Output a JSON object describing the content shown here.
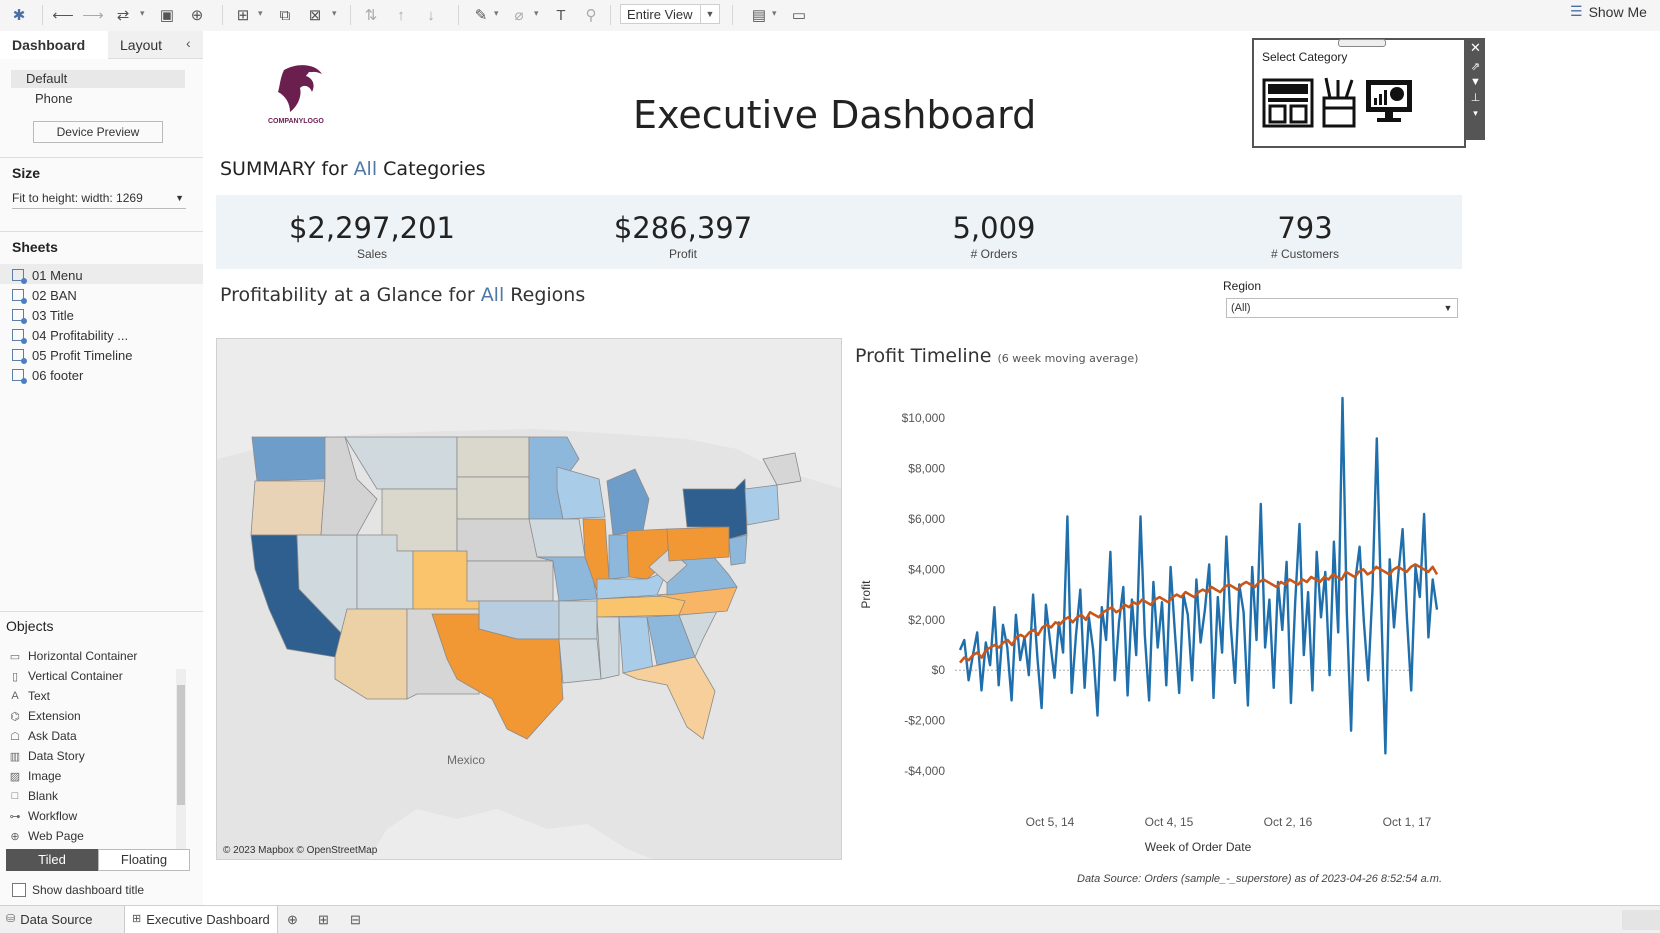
{
  "toolbar": {
    "entire_view": "Entire View",
    "show_me": "Show Me"
  },
  "left_pane": {
    "tabs": [
      "Dashboard",
      "Layout"
    ],
    "device": {
      "default": "Default",
      "phone": "Phone",
      "preview_button": "Device Preview"
    },
    "size": {
      "heading": "Size",
      "value": "Fit to height: width: 1269"
    },
    "sheets": {
      "heading": "Sheets",
      "items": [
        "01 Menu",
        "02 BAN",
        "03 Title",
        "04 Profitability ...",
        "05 Profit Timeline",
        "06 footer"
      ]
    },
    "objects": {
      "heading": "Objects",
      "items": [
        "Horizontal Container",
        "Vertical Container",
        "Text",
        "Extension",
        "Ask Data",
        "Data Story",
        "Image",
        "Blank",
        "Workflow",
        "Web Page"
      ]
    },
    "tiled": "Tiled",
    "floating": "Floating",
    "show_title": "Show dashboard title"
  },
  "dashboard": {
    "logo_text": "COMPANYLOGO",
    "title": "Executive Dashboard",
    "summary": {
      "prefix": "SUMMARY for ",
      "highlight": "All",
      "suffix": " Categories"
    },
    "bans": [
      {
        "value": "$2,297,201",
        "label": "Sales"
      },
      {
        "value": "$286,397",
        "label": "Profit"
      },
      {
        "value": "5,009",
        "label": "# Orders"
      },
      {
        "value": "793",
        "label": "# Customers"
      }
    ],
    "profitability": {
      "prefix": "Profitability at a Glance for ",
      "highlight": "All",
      "suffix": " Regions"
    },
    "region": {
      "label": "Region",
      "value": "(All)"
    },
    "map": {
      "label_mexico": "Mexico",
      "credit": "© 2023 Mapbox © OpenStreetMap"
    },
    "category_popup": {
      "title": "Select Category"
    },
    "footer": "Data Source: Orders (sample_-_superstore) as of 2023-04-26 8:52:54 a.m."
  },
  "bottom_bar": {
    "data_source": "Data Source",
    "active_tab": "Executive Dashboard"
  },
  "chart_data": {
    "type": "line",
    "title": "Profit Timeline",
    "subtitle": "(6 week moving average)",
    "xlabel": "Week of Order Date",
    "ylabel": "Profit",
    "y_ticks": [
      "$10,000",
      "$8,000",
      "$6,000",
      "$4,000",
      "$2,000",
      "$0",
      "-$2,000",
      "-$4,000"
    ],
    "x_ticks": [
      "Oct 5, 14",
      "Oct 4, 15",
      "Oct 2, 16",
      "Oct 1, 17"
    ],
    "ylim": [
      -4000,
      11000
    ],
    "colors": {
      "weekly": "#1f6fad",
      "moving_avg": "#c8571b"
    },
    "series": [
      {
        "values": [
          800,
          1200,
          -400,
          600,
          1500,
          -800,
          1100,
          200,
          2500,
          -600,
          1800,
          900,
          -1200,
          2200,
          400,
          1300,
          -200,
          3000,
          500,
          -1500,
          2600,
          1100,
          -300,
          1900,
          700,
          6100,
          -900,
          1400,
          3200,
          -700,
          2100,
          800,
          -1800,
          2500,
          1200,
          4700,
          -400,
          1900,
          3300,
          -1000,
          2800,
          600,
          6100,
          1400,
          -1200,
          3500,
          900,
          2700,
          -600,
          4100,
          1500,
          -900,
          3000,
          2200,
          -400,
          3600,
          1100,
          2400,
          4200,
          -1100,
          2900,
          700,
          5300,
          1800,
          -500,
          3400,
          2300,
          -1400,
          4100,
          1200,
          6600,
          900,
          2800,
          -700,
          3500,
          1600,
          4300,
          -1300,
          2700,
          5800,
          600,
          3100,
          -800,
          4700,
          2100,
          3900,
          -200,
          5100,
          1500,
          10800,
          2300,
          -2400,
          3600,
          4900,
          1900,
          -400,
          3200,
          9200,
          2700,
          -3300,
          4400,
          1700,
          3800,
          5600,
          2100,
          -800,
          4100,
          2900,
          6200,
          1300,
          3600,
          2400
        ]
      },
      {
        "values": [
          300,
          500,
          400,
          600,
          700,
          500,
          800,
          900,
          1000,
          900,
          1100,
          1200,
          1000,
          1300,
          1400,
          1300,
          1500,
          1600,
          1400,
          1700,
          1800,
          1700,
          1900,
          1800,
          2000,
          2100,
          1900,
          2100,
          2200,
          2000,
          2300,
          2200,
          2100,
          2300,
          2400,
          2500,
          2300,
          2400,
          2600,
          2500,
          2700,
          2600,
          2800,
          2700,
          2600,
          2800,
          2900,
          2800,
          2700,
          2900,
          3000,
          2900,
          3100,
          3000,
          2900,
          3100,
          3200,
          3100,
          3300,
          3200,
          3100,
          3300,
          3400,
          3300,
          3200,
          3400,
          3500,
          3400,
          3300,
          3500,
          3600,
          3500,
          3400,
          3300,
          3500,
          3400,
          3600,
          3500,
          3400,
          3600,
          3500,
          3700,
          3600,
          3500,
          3700,
          3600,
          3800,
          3700,
          3600,
          3900,
          3800,
          3700,
          3900,
          4000,
          3800,
          3900,
          4100,
          4000,
          3900,
          3800,
          4000,
          4100,
          4000,
          3900,
          4100,
          4200,
          4100,
          4000,
          3900,
          4100,
          3800
        ]
      }
    ]
  }
}
